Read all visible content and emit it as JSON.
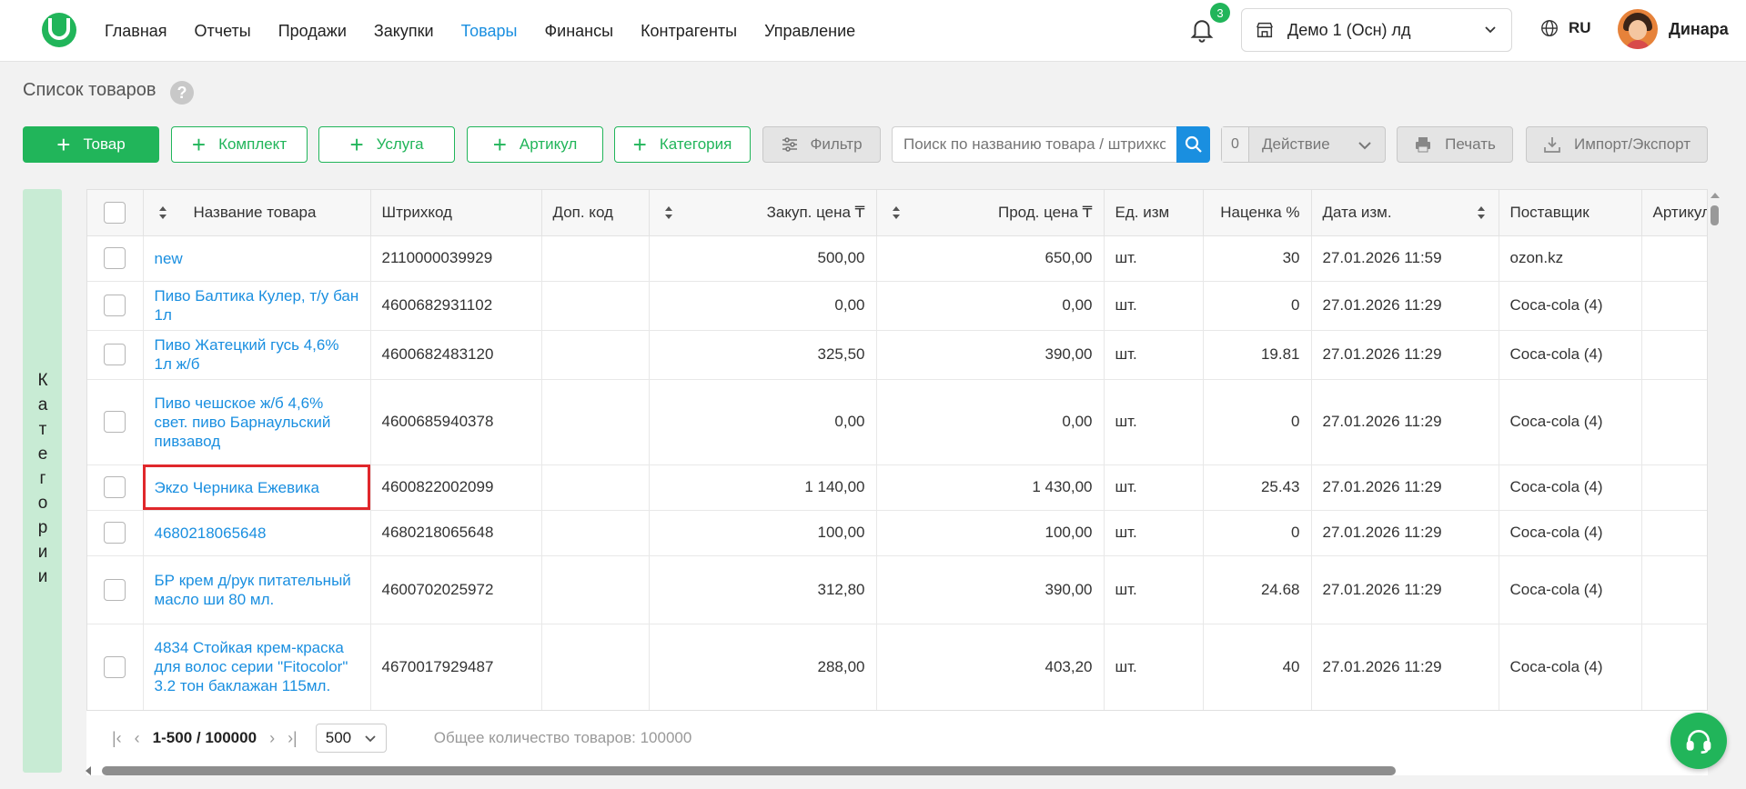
{
  "nav": {
    "items": [
      "Главная",
      "Отчеты",
      "Продажи",
      "Закупки",
      "Товары",
      "Финансы",
      "Контрагенты",
      "Управление"
    ],
    "active": "Товары"
  },
  "header": {
    "notifications_count": "3",
    "store": "Демо 1 (Осн) лд",
    "lang": "RU",
    "user": "Динара"
  },
  "page": {
    "title": "Список товаров",
    "help": "?"
  },
  "toolbar": {
    "add_product": "Товар",
    "add_kit": "Комплект",
    "add_service": "Услуга",
    "add_article": "Артикул",
    "add_category": "Категория",
    "filter": "Фильтр",
    "search_placeholder": "Поиск по названию товара / штрихкоду",
    "action_count": "0",
    "action": "Действие",
    "print": "Печать",
    "import_export": "Импорт/Экспорт"
  },
  "categories_label": "Категории",
  "table": {
    "columns": {
      "name": "Название товара",
      "barcode": "Штрихкод",
      "extra_code": "Доп. код",
      "purchase_price": "Закуп. цена ₸",
      "sale_price": "Прод. цена ₸",
      "unit": "Ед. изм",
      "markup": "Наценка %",
      "date": "Дата изм.",
      "supplier": "Поставщик",
      "article": "Артикул"
    },
    "rows": [
      {
        "name": "new",
        "barcode": "2110000039929",
        "extra": "",
        "purchase": "500,00",
        "sale": "650,00",
        "unit": "шт.",
        "markup": "30",
        "date": "27.01.2026 11:59",
        "supplier": "ozon.kz"
      },
      {
        "name": "Пиво Балтика Кулер, т/у бан 1л",
        "barcode": "4600682931102",
        "extra": "",
        "purchase": "0,00",
        "sale": "0,00",
        "unit": "шт.",
        "markup": "0",
        "date": "27.01.2026 11:29",
        "supplier": "Coca-cola (4)"
      },
      {
        "name": "Пиво Жатецкий гусь 4,6% 1л ж/б",
        "barcode": "4600682483120",
        "extra": "",
        "purchase": "325,50",
        "sale": "390,00",
        "unit": "шт.",
        "markup": "19.81",
        "date": "27.01.2026 11:29",
        "supplier": "Coca-cola (4)"
      },
      {
        "name": "Пиво чешское ж/б 4,6% свет. пиво Барнаульский пивзавод",
        "barcode": "4600685940378",
        "extra": "",
        "purchase": "0,00",
        "sale": "0,00",
        "unit": "шт.",
        "markup": "0",
        "date": "27.01.2026 11:29",
        "supplier": "Coca-cola (4)"
      },
      {
        "name": "Экzо Черника Ежевика",
        "barcode": "4600822002099",
        "extra": "",
        "purchase": "1 140,00",
        "sale": "1 430,00",
        "unit": "шт.",
        "markup": "25.43",
        "date": "27.01.2026 11:29",
        "supplier": "Coca-cola (4)"
      },
      {
        "name": "4680218065648",
        "barcode": "4680218065648",
        "extra": "",
        "purchase": "100,00",
        "sale": "100,00",
        "unit": "шт.",
        "markup": "0",
        "date": "27.01.2026 11:29",
        "supplier": "Coca-cola (4)"
      },
      {
        "name": "БР крем д/рук питательный масло ши 80 мл.",
        "barcode": "4600702025972",
        "extra": "",
        "purchase": "312,80",
        "sale": "390,00",
        "unit": "шт.",
        "markup": "24.68",
        "date": "27.01.2026 11:29",
        "supplier": "Coca-cola (4)"
      },
      {
        "name": "4834 Стойкая крем-краска для волос серии \"Fitocolor\" 3.2 тон баклажан 115мл.",
        "barcode": "4670017929487",
        "extra": "",
        "purchase": "288,00",
        "sale": "403,20",
        "unit": "шт.",
        "markup": "40",
        "date": "27.01.2026 11:29",
        "supplier": "Coca-cola (4)"
      }
    ]
  },
  "pager": {
    "range": "1-500 / 100000",
    "per_page": "500",
    "total": "Общее количество товаров: 100000"
  },
  "colors": {
    "accent": "#21b55a",
    "link": "#1a8fe0",
    "highlight": "#e0272b"
  }
}
